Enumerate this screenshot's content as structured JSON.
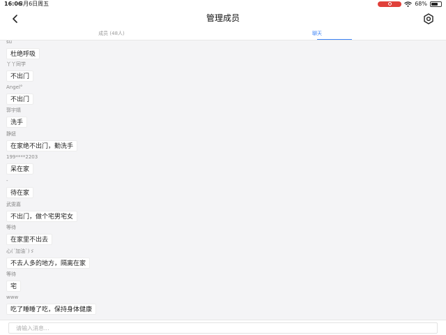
{
  "status_bar": {
    "time": "16:06",
    "date": "3月6日周五",
    "battery": "68%",
    "battery_level": 0.68,
    "recording_color": "#e0403a"
  },
  "nav": {
    "title": "管理成员",
    "back_icon": "chevron-left-icon",
    "settings_icon": "settings-icon"
  },
  "tabs": [
    {
      "label": "成员 (48人)",
      "active": false
    },
    {
      "label": "聊天",
      "active": true
    }
  ],
  "accent_color": "#3b82f6",
  "messages": [
    {
      "name": "su",
      "text": "杜绝呼吸"
    },
    {
      "name": "丫丫同学",
      "text": "不出门"
    },
    {
      "name": "Angel°",
      "text": "不出门"
    },
    {
      "name": "郭宇婧",
      "text": "洗手"
    },
    {
      "name": "静妞",
      "text": "在家绝不出门，勤洗手"
    },
    {
      "name": "199****2203",
      "text": "呆在家"
    },
    {
      "name": "-",
      "text": "待在家"
    },
    {
      "name": "武雯嘉",
      "text": "不出门，做个宅男宅女"
    },
    {
      "name": "等待",
      "text": "在家里不出去"
    },
    {
      "name": "心(´加油`)ゞ",
      "text": "不去人多的地方，隔离在家"
    },
    {
      "name": "等待",
      "text": "宅"
    },
    {
      "name": "www",
      "text": "吃了睡睡了吃，保持身体健康"
    }
  ],
  "composer": {
    "placeholder": "请输入消息..."
  }
}
